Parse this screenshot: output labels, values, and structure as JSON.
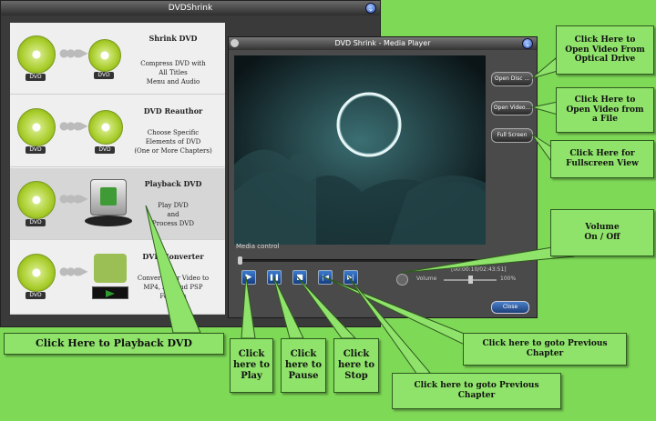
{
  "main_window": {
    "title": "DVDShrink",
    "close_symbol": "⌄",
    "menu": [
      {
        "title": "Shrink DVD",
        "desc": "Compress DVD with\nAll Titles\nMenu and Audio",
        "left_disc_label": "DVD",
        "right_disc_label": "DVD"
      },
      {
        "title": "DVD Reauthor",
        "desc": "Choose Specific\nElements of DVD\n(One or More Chapters)",
        "left_disc_label": "DVD",
        "right_disc_label": "DVD"
      },
      {
        "title": "Playback DVD",
        "desc": "Play DVD\nand\nProcess DVD",
        "left_disc_label": "DVD"
      },
      {
        "title": "DVD Converter",
        "desc": "Convert Your Video to\nMP4, AVI and PSP\nFormats",
        "left_disc_label": "DVD"
      }
    ]
  },
  "player_window": {
    "title": "DVD Shrink - Media Player",
    "close_symbol": "⌄",
    "buttons": {
      "open_disc": "Open Disc ...",
      "open_video": "Open Video...",
      "full_screen": "Full Screen",
      "close": "Close"
    },
    "media_control_label": "Media control",
    "time": "[00:00:10/02:43:51]",
    "volume_label": "Volume",
    "volume_pct": "100%",
    "controls": {
      "play": "▶",
      "pause": "❚❚",
      "stop": "■",
      "prev": "|◀",
      "next": "▶|"
    }
  },
  "callouts": {
    "open_optical": "Click Here to\nOpen Video From\nOptical Drive",
    "open_file": "Click Here to\nOpen Video from\na File",
    "fullscreen": "Click Here for\nFullscreen View",
    "volume": "Volume\nOn / Off",
    "playback": "Click Here to Playback DVD",
    "play": "Click\nhere to\nPlay",
    "pause": "Click\nhere to\nPause",
    "stop": "Click\nhere to\nStop",
    "prev_chapter_1": "Click here to goto Previous\nChapter",
    "prev_chapter_2": "Click here to goto Previous\nChapter"
  },
  "colors": {
    "background": "#7ed957",
    "callout_bg": "#8fe36a",
    "button_blue": "#2a5bb8"
  }
}
